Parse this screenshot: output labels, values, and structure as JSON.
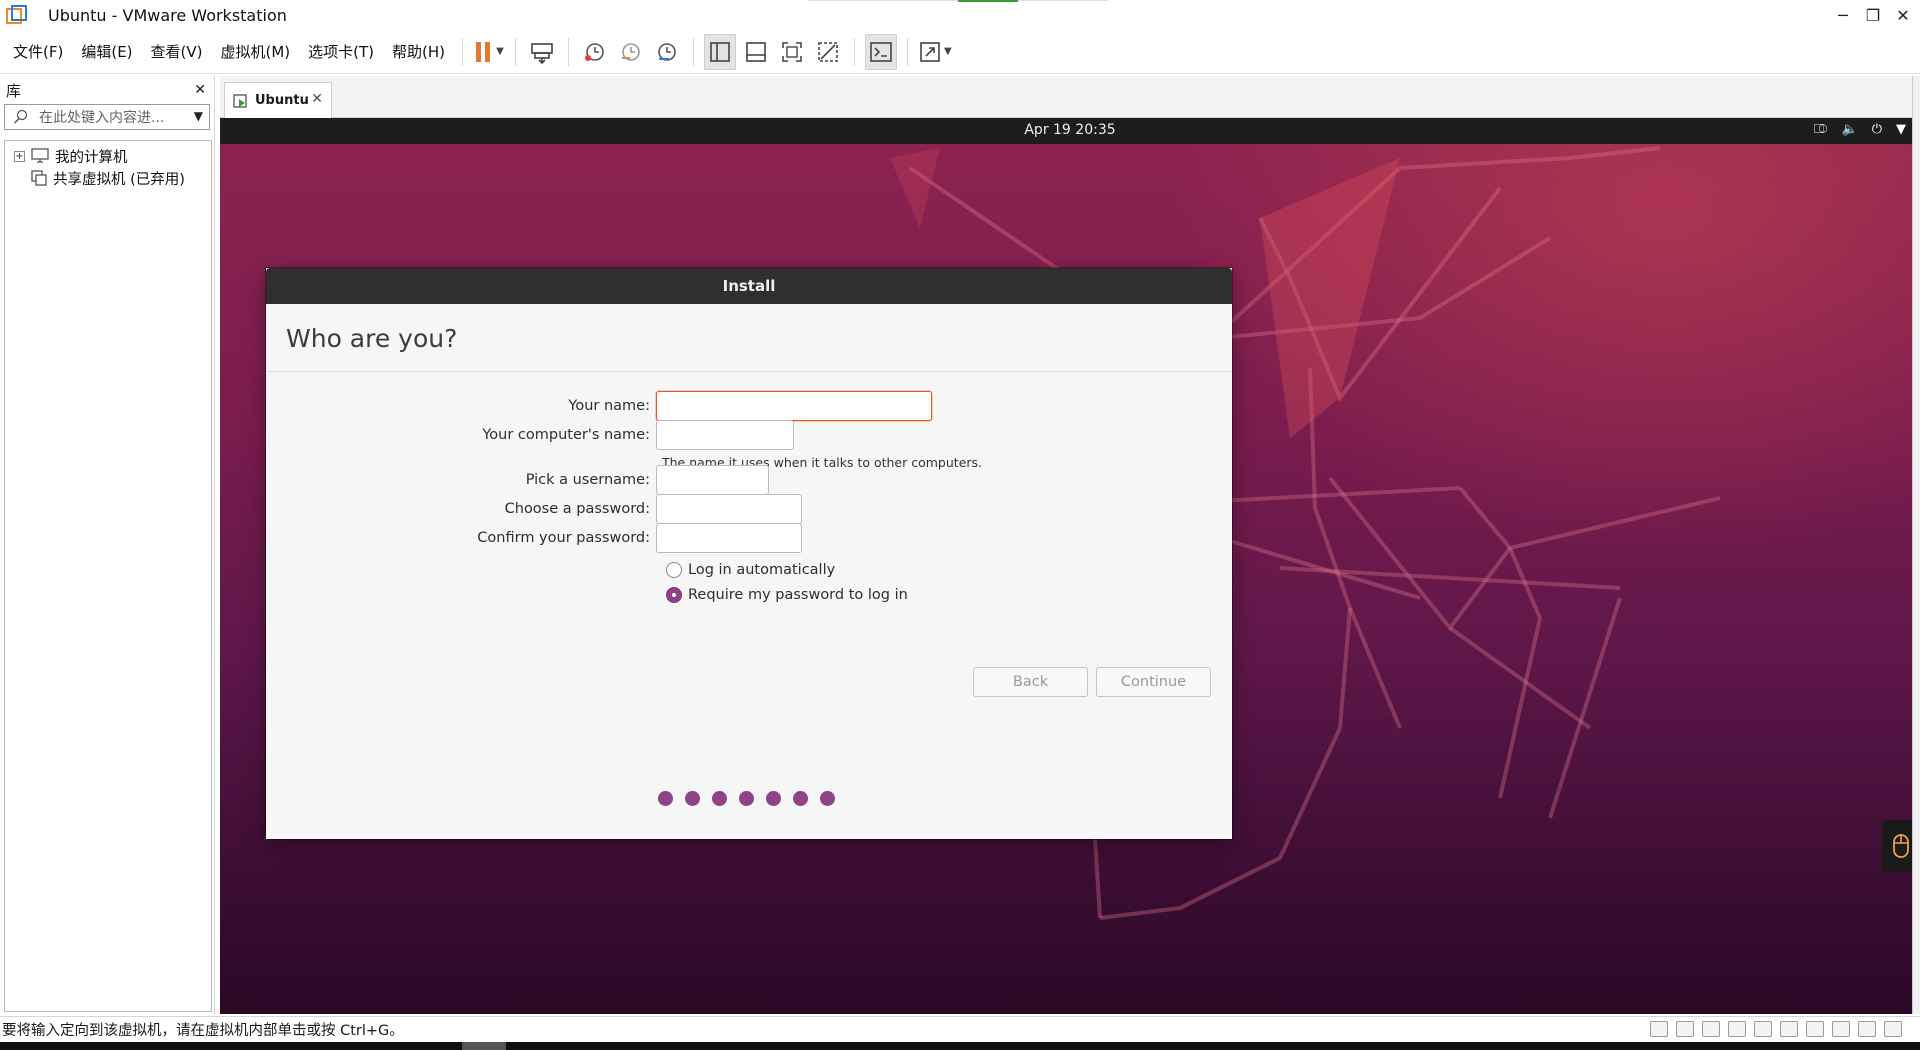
{
  "window": {
    "title": "Ubuntu - VMware Workstation",
    "controls": {
      "minimize": "─",
      "restore": "❐",
      "close": "✕"
    }
  },
  "menu": {
    "items": [
      "文件(F)",
      "编辑(E)",
      "查看(V)",
      "虚拟机(M)",
      "选项卡(T)",
      "帮助(H)"
    ]
  },
  "library": {
    "title": "库",
    "close": "✕",
    "search_placeholder": "在此处键入内容进...",
    "tree": [
      "我的计算机",
      "共享虚拟机 (已弃用)"
    ]
  },
  "vm_tab": {
    "label": "Ubuntu",
    "close": "✕"
  },
  "guest": {
    "clock": "Apr 19  20:35",
    "tray_icons": [
      "network-icon",
      "volume-icon",
      "power-icon",
      "menu-caret-icon"
    ]
  },
  "installer": {
    "window_title": "Install",
    "heading": "Who are you?",
    "fields": {
      "name_label": "Your name:",
      "computer_label": "Your computer's name:",
      "computer_hint": "The name it uses when it talks to other computers.",
      "username_label": "Pick a username:",
      "password_label": "Choose a password:",
      "confirm_label": "Confirm your password:"
    },
    "options": {
      "auto_login": "Log in automatically",
      "require_password": "Require my password to log in",
      "selected": "require_password"
    },
    "buttons": {
      "back": "Back",
      "continue": "Continue"
    },
    "progress_steps": 7
  },
  "statusbar": {
    "message": "要将输入定向到该虚拟机，请在虚拟机内部单击或按 Ctrl+G。"
  },
  "colors": {
    "accent_orange": "#e9541f",
    "ubuntu_purple": "#8d4385",
    "pause_orange": "#e8772e"
  }
}
